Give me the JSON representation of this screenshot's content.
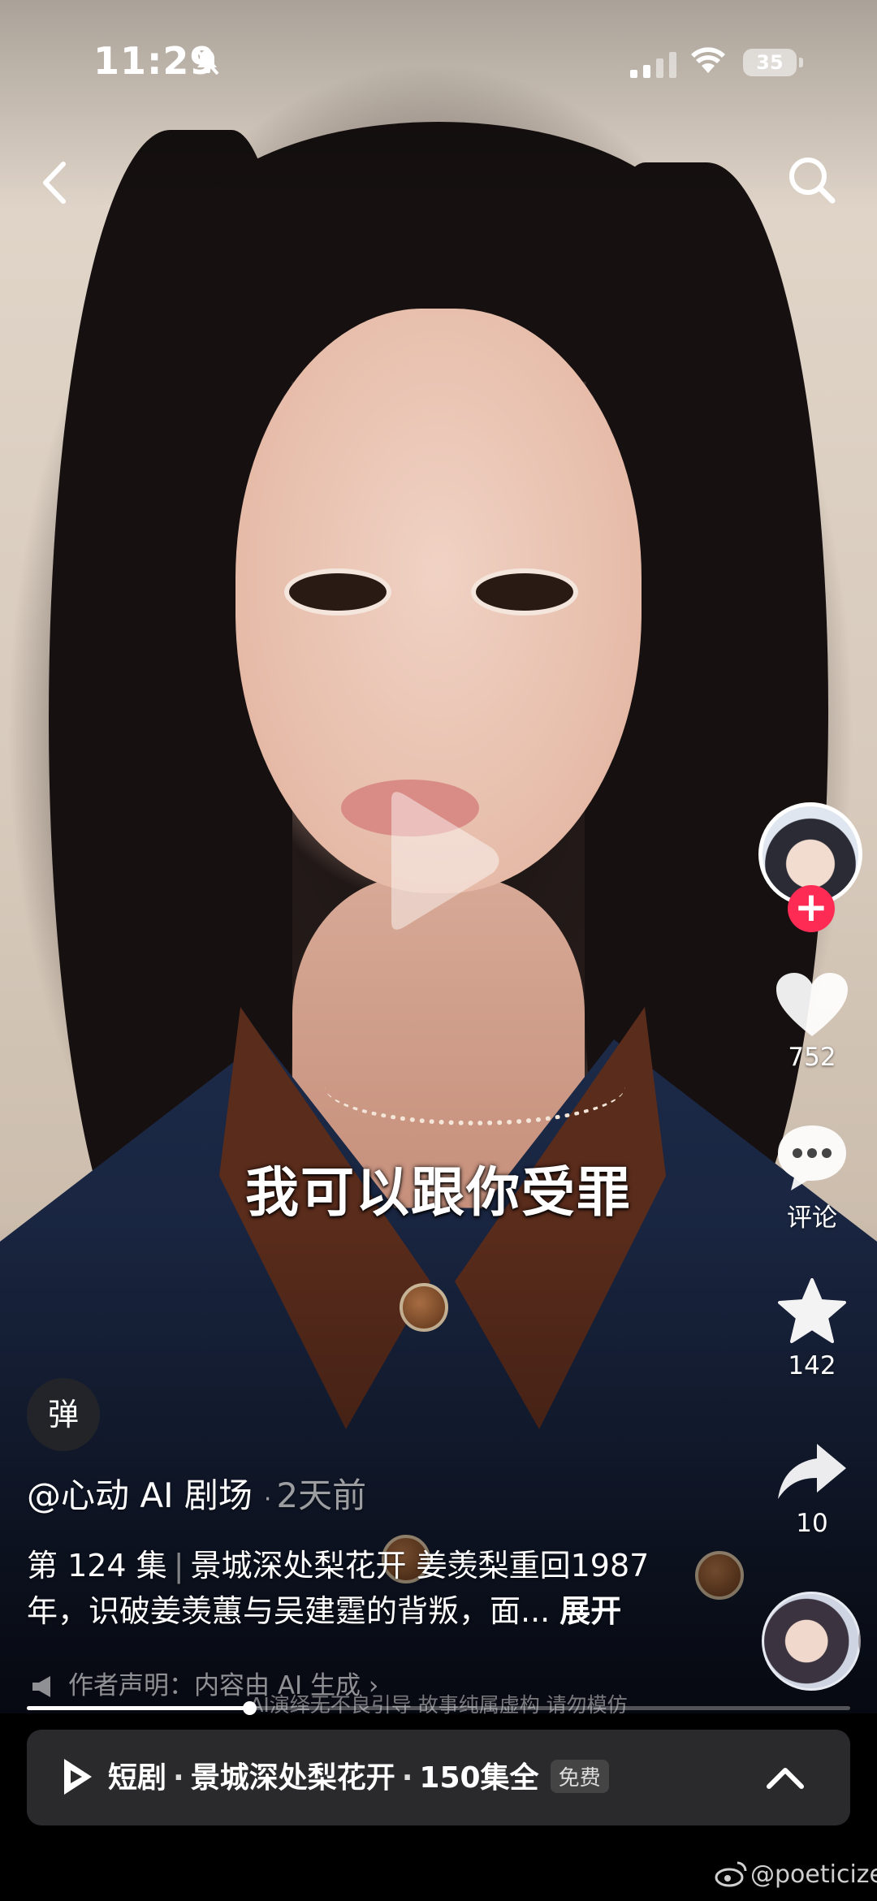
{
  "status_bar": {
    "time": "11:29",
    "battery": "35"
  },
  "video": {
    "subtitle": "我可以跟你受罪"
  },
  "actions": {
    "likes": "752",
    "comments": "评论",
    "favorites": "142",
    "shares": "10"
  },
  "danmaku_label": "弹",
  "author": {
    "name": "@心动 AI 剧场",
    "dot": "·",
    "time_ago": "2天前"
  },
  "description": {
    "episode": "第 124 集",
    "separator": "|",
    "text": "景城深处梨花开 姜羡梨重回1987年，识破姜羡蕙与吴建霆的背叛，面...",
    "expand": "展开"
  },
  "declaration": "作者声明：内容由 AI 生成 ›",
  "ai_notice": "AI演绎无不良引导 故事纯属虚构 请勿模仿",
  "playback": {
    "progress": 0.27
  },
  "drama_bar": {
    "label": "短剧",
    "dot": "·",
    "title": "景城深处梨花开",
    "episodes": "150集全",
    "badge": "免费"
  },
  "watermark": "@poeticize",
  "colors": {
    "follow": "#fe2c55",
    "bar_bg": "#2a2a2c"
  }
}
